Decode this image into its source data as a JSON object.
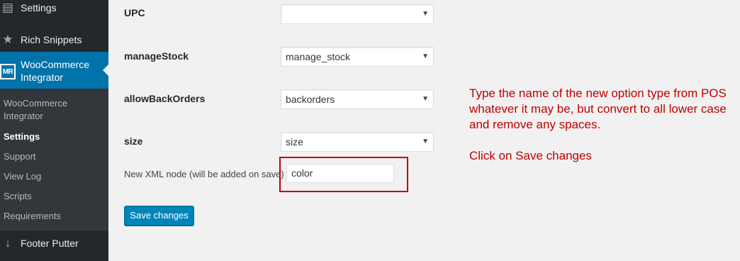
{
  "sidebar": {
    "top_items": [
      {
        "label": "Settings"
      },
      {
        "label": "Rich Snippets"
      },
      {
        "label": "WooCommerce Integrator",
        "icon_text": "MR"
      },
      {
        "label": "Footer Putter"
      }
    ],
    "submenu": [
      "WooCommerce Integrator",
      "Settings",
      "Support",
      "View Log",
      "Scripts",
      "Requirements"
    ],
    "current_sub": "Settings"
  },
  "form": {
    "fields": [
      {
        "label": "UPC",
        "value": ""
      },
      {
        "label": "manageStock",
        "value": "manage_stock"
      },
      {
        "label": "allowBackOrders",
        "value": "backorders"
      },
      {
        "label": "size",
        "value": "size"
      }
    ],
    "new_node_label": "New XML node (will be added on save)",
    "new_node_value": "color",
    "save_label": "Save changes"
  },
  "annotation": {
    "para1": "Type the name of the new option type from POS  whatever it may be, but convert to all lower case and remove any spaces.",
    "para2": "Click on Save changes"
  },
  "colors": {
    "sidebar": "#23282d",
    "submenu": "#32373c",
    "active": "#0073aa",
    "button": "#0085ba",
    "annotation": "#c00000"
  }
}
